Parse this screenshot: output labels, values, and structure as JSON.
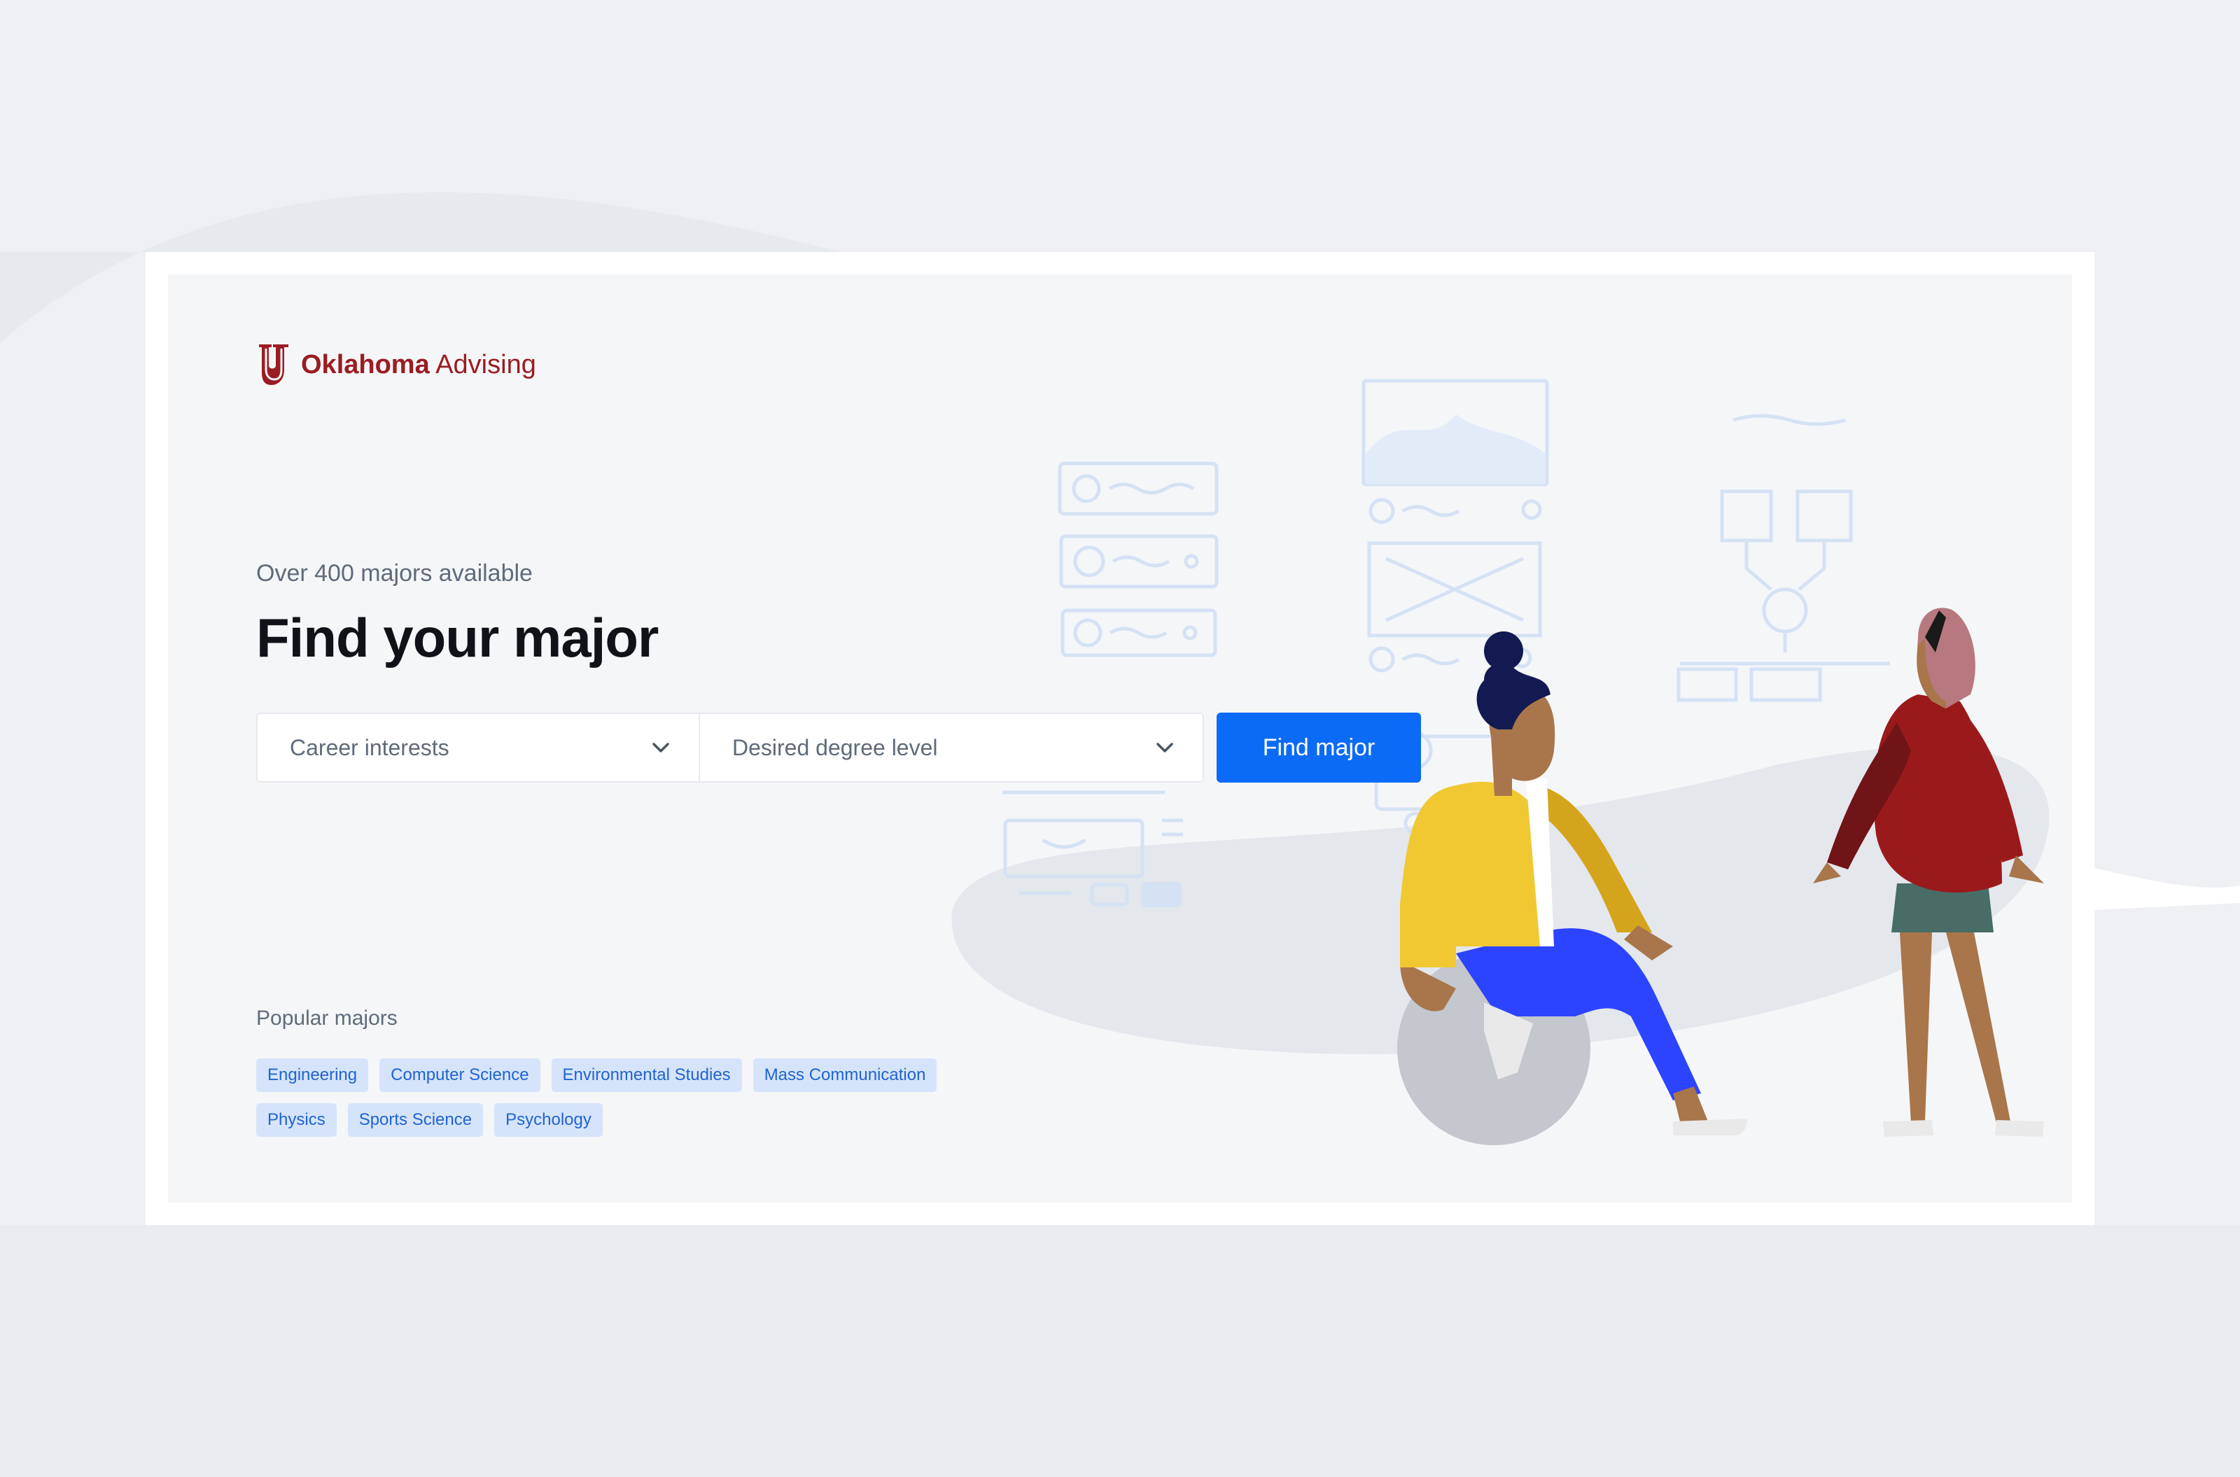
{
  "brand": {
    "name_bold": "Oklahoma",
    "name_light": "Advising",
    "color": "#9b1c22"
  },
  "hero": {
    "subtitle": "Over 400 majors available",
    "title": "Find your major"
  },
  "search": {
    "career_select": "Career interests",
    "degree_select": "Desired degree level",
    "submit_label": "Find major",
    "accent": "#0b6bf6"
  },
  "popular": {
    "label": "Popular majors",
    "rows": [
      [
        "Engineering",
        "Computer Science",
        "Environmental Studies",
        "Mass Communication"
      ],
      [
        "Physics",
        "Sports Science",
        "Psychology"
      ]
    ]
  }
}
